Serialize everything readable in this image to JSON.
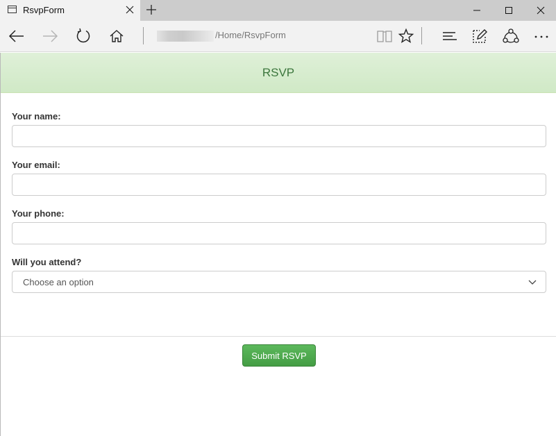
{
  "browser": {
    "tab_title": "RsvpForm",
    "address_path": "/Home/RsvpForm"
  },
  "page": {
    "header_title": "RSVP",
    "fields": {
      "name_label": "Your name:",
      "name_value": "",
      "email_label": "Your email:",
      "email_value": "",
      "phone_label": "Your phone:",
      "phone_value": "",
      "attend_label": "Will you attend?",
      "attend_selected": "Choose an option"
    },
    "submit_label": "Submit RSVP"
  },
  "colors": {
    "header_bg": "#dff0d8",
    "header_text": "#3c763d",
    "submit_bg": "#5cb85c"
  },
  "icons": [
    "page-icon",
    "close-icon",
    "plus-icon",
    "minimize-icon",
    "maximize-icon",
    "back-arrow-icon",
    "forward-arrow-icon",
    "refresh-icon",
    "home-icon",
    "reading-view-icon",
    "favorite-star-icon",
    "hub-icon",
    "web-note-icon",
    "share-icon",
    "more-icon",
    "chevron-down-icon"
  ]
}
